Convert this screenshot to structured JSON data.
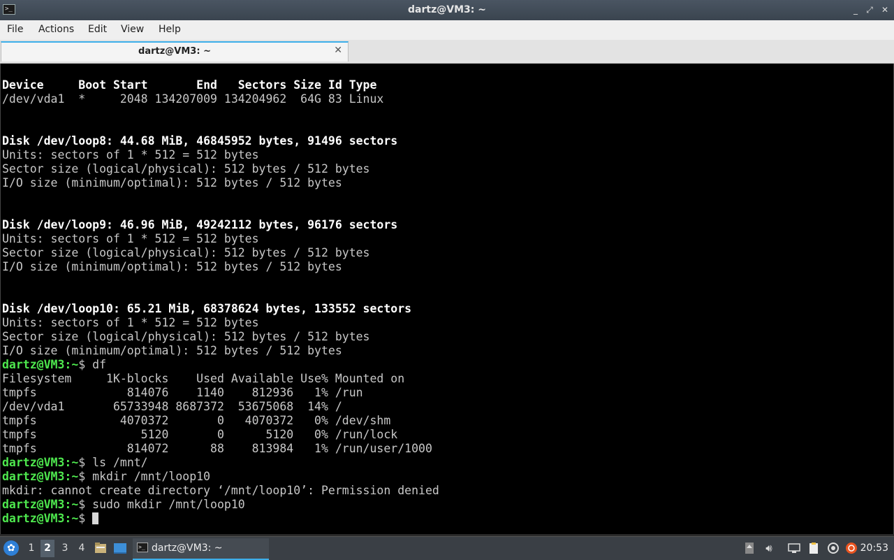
{
  "window": {
    "title": "dartz@VM3: ~",
    "app_icon": ">_",
    "controls": [
      "_",
      "⤢",
      "✕"
    ]
  },
  "menu": [
    "File",
    "Actions",
    "Edit",
    "View",
    "Help"
  ],
  "tab": {
    "label": "dartz@VM3: ~",
    "close": "✕"
  },
  "terminal": {
    "lines": [
      {
        "text": "Device     Boot Start       End   Sectors Size Id Type",
        "style": "bold"
      },
      {
        "text": "/dev/vda1  *     2048 134207009 134204962  64G 83 Linux",
        "style": "normal"
      },
      {
        "text": "",
        "style": "normal"
      },
      {
        "text": "",
        "style": "normal"
      },
      {
        "text": "Disk /dev/loop8: 44.68 MiB, 46845952 bytes, 91496 sectors",
        "style": "bold"
      },
      {
        "text": "Units: sectors of 1 * 512 = 512 bytes",
        "style": "normal"
      },
      {
        "text": "Sector size (logical/physical): 512 bytes / 512 bytes",
        "style": "normal"
      },
      {
        "text": "I/O size (minimum/optimal): 512 bytes / 512 bytes",
        "style": "normal"
      },
      {
        "text": "",
        "style": "normal"
      },
      {
        "text": "",
        "style": "normal"
      },
      {
        "text": "Disk /dev/loop9: 46.96 MiB, 49242112 bytes, 96176 sectors",
        "style": "bold"
      },
      {
        "text": "Units: sectors of 1 * 512 = 512 bytes",
        "style": "normal"
      },
      {
        "text": "Sector size (logical/physical): 512 bytes / 512 bytes",
        "style": "normal"
      },
      {
        "text": "I/O size (minimum/optimal): 512 bytes / 512 bytes",
        "style": "normal"
      },
      {
        "text": "",
        "style": "normal"
      },
      {
        "text": "",
        "style": "normal"
      },
      {
        "text": "Disk /dev/loop10: 65.21 MiB, 68378624 bytes, 133552 sectors",
        "style": "bold"
      },
      {
        "text": "Units: sectors of 1 * 512 = 512 bytes",
        "style": "normal"
      },
      {
        "text": "Sector size (logical/physical): 512 bytes / 512 bytes",
        "style": "normal"
      },
      {
        "text": "I/O size (minimum/optimal): 512 bytes / 512 bytes",
        "style": "normal"
      },
      {
        "prompt": "dartz@VM3:~",
        "text": "$ df",
        "style": "prompt"
      },
      {
        "text": "Filesystem     1K-blocks    Used Available Use% Mounted on",
        "style": "normal"
      },
      {
        "text": "tmpfs             814076    1140    812936   1% /run",
        "style": "normal"
      },
      {
        "text": "/dev/vda1       65733948 8687372  53675068  14% /",
        "style": "normal"
      },
      {
        "text": "tmpfs            4070372       0   4070372   0% /dev/shm",
        "style": "normal"
      },
      {
        "text": "tmpfs               5120       0      5120   0% /run/lock",
        "style": "normal"
      },
      {
        "text": "tmpfs             814072      88    813984   1% /run/user/1000",
        "style": "normal"
      },
      {
        "prompt": "dartz@VM3:~",
        "text": "$ ls /mnt/",
        "style": "prompt"
      },
      {
        "prompt": "dartz@VM3:~",
        "text": "$ mkdir /mnt/loop10",
        "style": "prompt"
      },
      {
        "text": "mkdir: cannot create directory ‘/mnt/loop10’: Permission denied",
        "style": "normal"
      },
      {
        "prompt": "dartz@VM3:~",
        "text": "$ sudo mkdir /mnt/loop10",
        "style": "prompt"
      },
      {
        "prompt": "dartz@VM3:~",
        "text": "$ ",
        "style": "prompt",
        "cursor": true
      }
    ]
  },
  "taskbar": {
    "workspaces": [
      "1",
      "2",
      "3",
      "4"
    ],
    "active_workspace": "2",
    "task_label": "dartz@VM3: ~",
    "task_icon": ">_",
    "clock": "20:53"
  }
}
